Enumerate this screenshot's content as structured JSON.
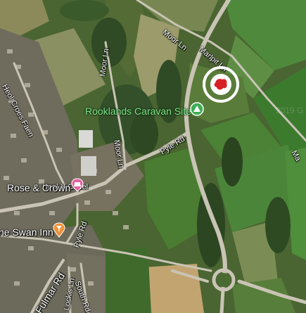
{
  "map": {
    "type": "satellite",
    "roads": {
      "moor_ln_top": "Moor Ln",
      "marlpit_ln": "Marlpit Ln",
      "moor_ln_left": "Moor Ln",
      "moor_ln_mid": "Moor Ln",
      "heol_croes_faen": "Heol Croes Faen",
      "pyle_rd_mid": "Pyle Rd",
      "heol_y_capel": "Heol-Y-Capel",
      "pyle_rd_low": "Pyle Rd",
      "fulmar_rd": "Fulmar Rd",
      "south_rd": "South Rd",
      "locks_ln": "Lock's Ln",
      "edge_ma": "Ma"
    },
    "places": {
      "caravan_site": "Rooklands Caravan Site",
      "rose_crown": "Rose & Crown",
      "swan_inn": "ne Swan Inn"
    },
    "watermark": "2019 G",
    "colors": {
      "caravan_label": "#7ee08a",
      "hotel_pin": "#e85fa3",
      "bar_pin": "#f0923a",
      "campsite_pin": "#3dae55",
      "marker_ring": "#ffffff",
      "marker_icon": "#d81f26"
    }
  }
}
